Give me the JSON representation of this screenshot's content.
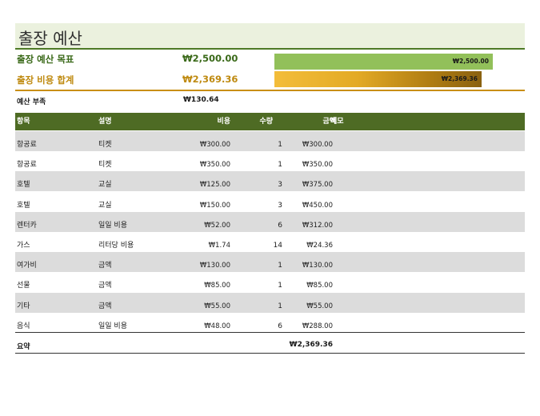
{
  "title": "출장 예산",
  "summary": {
    "budget_label": "출장 예산 목표",
    "budget_value": "₩2,500.00",
    "budget_bar_text": "₩2,500.00",
    "total_label": "출장 비용 합계",
    "total_value": "₩2,369.36",
    "total_bar_text": "₩2,369.36",
    "shortfall_label": "예산 부족",
    "shortfall_value": "₩130.64",
    "budget_bar_fraction": 1.0,
    "total_bar_fraction": 0.948,
    "colors": {
      "budget_bar": "#92c05a",
      "total_bar": "#e3aa25",
      "header": "#4e6b24",
      "accent_gold": "#c98f12"
    }
  },
  "table": {
    "headers": {
      "item": "항목",
      "description": "설명",
      "cost": "비용",
      "qty": "수량",
      "amount": "금액",
      "memo": "메모"
    },
    "rows": [
      {
        "item": "항공료",
        "description": "티켓",
        "cost": "₩300.00",
        "qty": "1",
        "amount": "₩300.00"
      },
      {
        "item": "항공료",
        "description": "티켓",
        "cost": "₩350.00",
        "qty": "1",
        "amount": "₩350.00"
      },
      {
        "item": "호텔",
        "description": "교실",
        "cost": "₩125.00",
        "qty": "3",
        "amount": "₩375.00"
      },
      {
        "item": "호텔",
        "description": "교실",
        "cost": "₩150.00",
        "qty": "3",
        "amount": "₩450.00"
      },
      {
        "item": "렌터카",
        "description": "일일 비용",
        "cost": "₩52.00",
        "qty": "6",
        "amount": "₩312.00"
      },
      {
        "item": "가스",
        "description": "리터당 비용",
        "cost": "₩1.74",
        "qty": "14",
        "amount": "₩24.36"
      },
      {
        "item": "여가비",
        "description": "금액",
        "cost": "₩130.00",
        "qty": "1",
        "amount": "₩130.00"
      },
      {
        "item": "선물",
        "description": "금액",
        "cost": "₩85.00",
        "qty": "1",
        "amount": "₩85.00"
      },
      {
        "item": "기타",
        "description": "금액",
        "cost": "₩55.00",
        "qty": "1",
        "amount": "₩55.00"
      },
      {
        "item": "음식",
        "description": "일일 비용",
        "cost": "₩48.00",
        "qty": "6",
        "amount": "₩288.00"
      }
    ],
    "total_label": "요약",
    "total_value": "₩2,369.36"
  }
}
